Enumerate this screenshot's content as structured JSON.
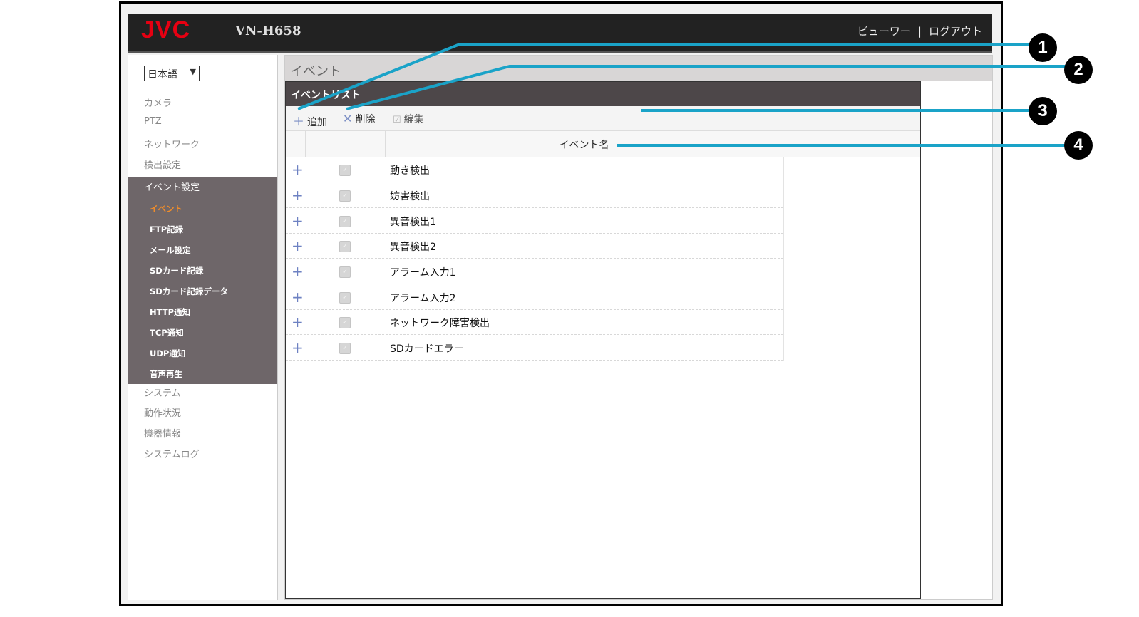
{
  "header": {
    "logo": "JVC",
    "model": "VN-H658",
    "viewer_link": "ビューワー",
    "separator": "|",
    "logout_link": "ログアウト"
  },
  "sidebar": {
    "language": "日本語",
    "items_top": [
      "カメラ",
      "PTZ",
      "ネットワーク",
      "検出設定"
    ],
    "group_label": "イベント設定",
    "group_items": [
      "イベント",
      "FTP記録",
      "メール設定",
      "SDカード記録",
      "SDカード記録データ",
      "HTTP通知",
      "TCP通知",
      "UDP通知",
      "音声再生"
    ],
    "active_item": "イベント",
    "items_bottom": [
      "システム",
      "動作状況",
      "機器情報",
      "システムログ"
    ]
  },
  "main": {
    "page_title": "イベント",
    "panel_title": "イベントリスト",
    "toolbar": {
      "add_label": "追加",
      "delete_label": "削除",
      "edit_label": "編集"
    },
    "table": {
      "column_header": "イベント名",
      "rows": [
        "動き検出",
        "妨害検出",
        "異音検出1",
        "異音検出2",
        "アラーム入力1",
        "アラーム入力2",
        "ネットワーク障害検出",
        "SDカードエラー"
      ]
    }
  },
  "callouts": [
    "1",
    "2",
    "3",
    "4"
  ],
  "colors": {
    "logo_red": "#e60012",
    "header_bg": "#222222",
    "group_bg": "#6e6669",
    "active_item": "#f08c2a",
    "leader_line": "#1aa3c8",
    "icon_blue": "#6d81c2"
  }
}
